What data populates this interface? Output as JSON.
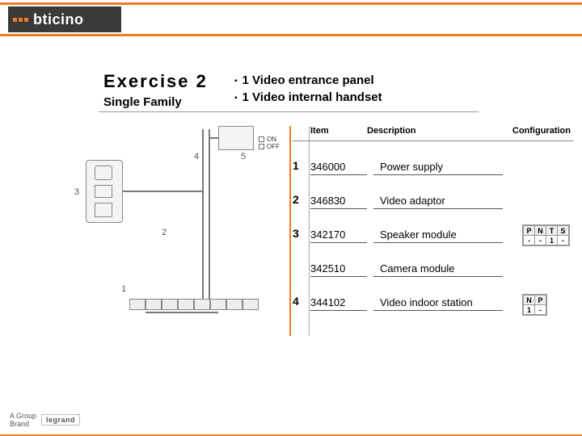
{
  "brand": {
    "logo_text": "bticino"
  },
  "title": {
    "main": "Exercise 2",
    "sub": "Single Family"
  },
  "bullets": [
    "1 Video entrance panel",
    "1 Video internal handset"
  ],
  "diagram": {
    "labels": {
      "n1": "1",
      "n2": "2",
      "n3": "3",
      "n4": "4",
      "n5": "5",
      "on": "ON",
      "off": "OFF"
    }
  },
  "table": {
    "headers": {
      "item": "Item",
      "desc": "Description",
      "conf": "Configuration"
    },
    "rows": [
      {
        "n": "1",
        "item": "346000",
        "desc": "Power supply"
      },
      {
        "n": "2",
        "item": "346830",
        "desc": "Video adaptor"
      },
      {
        "n": "3",
        "item": "342170",
        "desc": "Speaker module"
      },
      {
        "n": "",
        "item": "342510",
        "desc": "Camera module"
      },
      {
        "n": "4",
        "item": "344102",
        "desc": "Video indoor station"
      }
    ]
  },
  "config": {
    "a": {
      "headers": [
        "P",
        "N",
        "T",
        "S"
      ],
      "values": [
        "-",
        "-",
        "1",
        "-"
      ]
    },
    "b": {
      "headers": [
        "N",
        "P"
      ],
      "values": [
        "1",
        "-"
      ]
    }
  },
  "footer": {
    "group": "A Group",
    "brand": "Brand",
    "legrand": "legrand"
  }
}
